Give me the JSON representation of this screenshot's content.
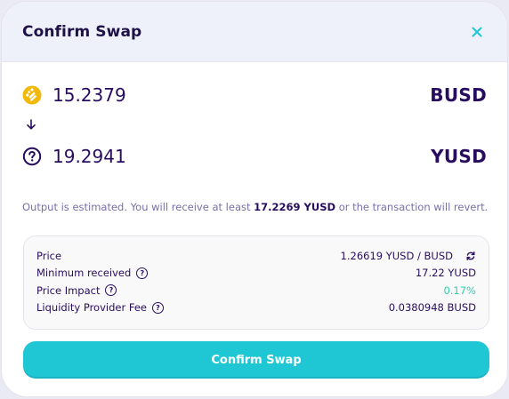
{
  "modal": {
    "title": "Confirm Swap"
  },
  "input": {
    "icon": "busd-token-icon",
    "amount": "15.2379",
    "symbol": "BUSD"
  },
  "output": {
    "icon": "unknown-token-icon",
    "amount": "19.2941",
    "symbol": "YUSD"
  },
  "note": {
    "prefix": "Output is estimated. You will receive at least ",
    "minimum": "17.2269 YUSD",
    "suffix": " or the transaction will revert."
  },
  "details": {
    "price_label": "Price",
    "price_value": "1.26619 YUSD / BUSD",
    "min_received_label": "Minimum received",
    "min_received_value": "17.22 YUSD",
    "price_impact_label": "Price Impact",
    "price_impact_value": "0.17%",
    "lp_fee_label": "Liquidity Provider Fee",
    "lp_fee_value": "0.0380948 BUSD"
  },
  "confirm_button": {
    "label": "Confirm Swap"
  },
  "colors": {
    "accent": "#1fc7d4",
    "success": "#31d0aa",
    "text": "#280d5f",
    "muted": "#7a6eaa",
    "busd": "#f0b90b"
  }
}
